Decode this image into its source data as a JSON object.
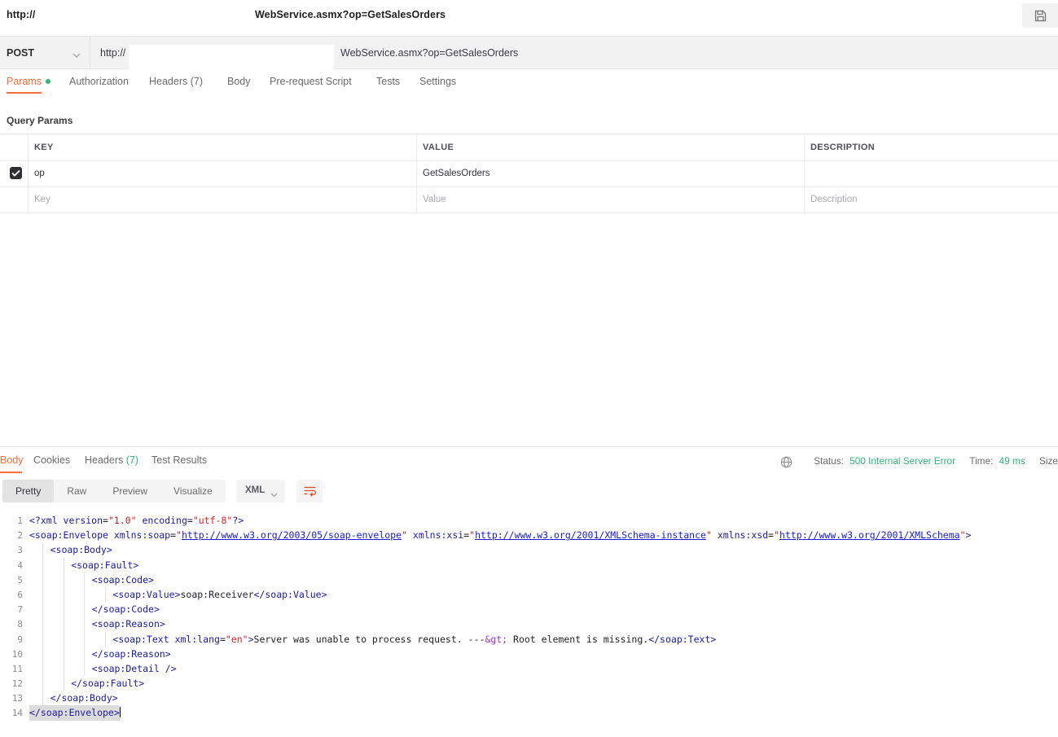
{
  "window": {
    "tab_title_prefix": "http://",
    "tab_title_suffix": "WebService.asmx?op=GetSalesOrders",
    "save_icon": "save-icon"
  },
  "request": {
    "method": "POST",
    "url_prefix": "http://",
    "url_suffix": "WebService.asmx?op=GetSalesOrders",
    "tabs": [
      {
        "label": "Params",
        "active": true,
        "has_dot": true
      },
      {
        "label": "Authorization",
        "active": false,
        "has_dot": false
      },
      {
        "label": "Headers (7)",
        "active": false,
        "has_dot": false
      },
      {
        "label": "Body",
        "active": false,
        "has_dot": false
      },
      {
        "label": "Pre-request Script",
        "active": false,
        "has_dot": false
      },
      {
        "label": "Tests",
        "active": false,
        "has_dot": false
      },
      {
        "label": "Settings",
        "active": false,
        "has_dot": false
      }
    ],
    "section_label": "Query Params",
    "table": {
      "headers": [
        "KEY",
        "VALUE",
        "DESCRIPTION"
      ],
      "rows": [
        {
          "checked": true,
          "key": "op",
          "value": "GetSalesOrders",
          "description": ""
        }
      ],
      "placeholder_row": {
        "key": "Key",
        "value": "Value",
        "description": "Description"
      }
    }
  },
  "response": {
    "tabs": [
      {
        "label": "Body",
        "active": true
      },
      {
        "label": "Cookies",
        "active": false
      },
      {
        "label": "Headers",
        "count": "(7)",
        "active": false
      },
      {
        "label": "Test Results",
        "active": false
      }
    ],
    "status_icon": "globe-icon",
    "status_label": "Status:",
    "status_value": "500 Internal Server Error",
    "time_label": "Time:",
    "time_value": "49 ms",
    "size_label": "Size",
    "format_tabs": [
      {
        "label": "Pretty",
        "active": true
      },
      {
        "label": "Raw",
        "active": false
      },
      {
        "label": "Preview",
        "active": false
      },
      {
        "label": "Visualize",
        "active": false
      }
    ],
    "language": "XML",
    "wrap_icon": "wrap-lines-icon",
    "accent_color": "#ff6c37",
    "status_color": "#31b57a",
    "body_lines": [
      {
        "n": "1",
        "parts": [
          {
            "t": "tag",
            "s": "<?xml "
          },
          {
            "t": "attr",
            "s": "version"
          },
          {
            "t": "txt",
            "s": "="
          },
          {
            "t": "str",
            "s": "\"1.0\""
          },
          {
            "t": "txt",
            "s": " "
          },
          {
            "t": "attr",
            "s": "encoding"
          },
          {
            "t": "txt",
            "s": "="
          },
          {
            "t": "str",
            "s": "\"utf-8\""
          },
          {
            "t": "tag",
            "s": "?>"
          }
        ]
      },
      {
        "n": "2",
        "parts": [
          {
            "t": "tag",
            "s": "<soap:Envelope "
          },
          {
            "t": "attr",
            "s": "xmlns:soap"
          },
          {
            "t": "txt",
            "s": "="
          },
          {
            "t": "str",
            "s": "\""
          },
          {
            "t": "url",
            "s": "http://www.w3.org/2003/05/soap-envelope"
          },
          {
            "t": "str",
            "s": "\""
          },
          {
            "t": "txt",
            "s": " "
          },
          {
            "t": "attr",
            "s": "xmlns:xsi"
          },
          {
            "t": "txt",
            "s": "="
          },
          {
            "t": "str",
            "s": "\""
          },
          {
            "t": "url",
            "s": "http://www.w3.org/2001/XMLSchema-instance"
          },
          {
            "t": "str",
            "s": "\""
          },
          {
            "t": "txt",
            "s": " "
          },
          {
            "t": "attr",
            "s": "xmlns:xsd"
          },
          {
            "t": "txt",
            "s": "="
          },
          {
            "t": "str",
            "s": "\""
          },
          {
            "t": "url",
            "s": "http://www.w3.org/2001/XMLSchema"
          },
          {
            "t": "str",
            "s": "\""
          },
          {
            "t": "tag",
            "s": ">"
          }
        ]
      },
      {
        "n": "3",
        "indent": 1,
        "parts": [
          {
            "t": "tag",
            "s": "<soap:Body>"
          }
        ]
      },
      {
        "n": "4",
        "indent": 2,
        "parts": [
          {
            "t": "tag",
            "s": "<soap:Fault>"
          }
        ]
      },
      {
        "n": "5",
        "indent": 3,
        "parts": [
          {
            "t": "tag",
            "s": "<soap:Code>"
          }
        ]
      },
      {
        "n": "6",
        "indent": 4,
        "parts": [
          {
            "t": "tag",
            "s": "<soap:Value>"
          },
          {
            "t": "txt",
            "s": "soap:Receiver"
          },
          {
            "t": "tag",
            "s": "</soap:Value>"
          }
        ]
      },
      {
        "n": "7",
        "indent": 3,
        "parts": [
          {
            "t": "tag",
            "s": "</soap:Code>"
          }
        ]
      },
      {
        "n": "8",
        "indent": 3,
        "parts": [
          {
            "t": "tag",
            "s": "<soap:Reason>"
          }
        ]
      },
      {
        "n": "9",
        "indent": 4,
        "parts": [
          {
            "t": "tag",
            "s": "<soap:Text "
          },
          {
            "t": "attr",
            "s": "xml:lang"
          },
          {
            "t": "txt",
            "s": "="
          },
          {
            "t": "str",
            "s": "\"en\""
          },
          {
            "t": "tag",
            "s": ">"
          },
          {
            "t": "txt",
            "s": "Server was unable to process request. ---"
          },
          {
            "t": "ent",
            "s": "&gt;"
          },
          {
            "t": "txt",
            "s": " Root element is missing."
          },
          {
            "t": "tag",
            "s": "</soap:Text>"
          }
        ]
      },
      {
        "n": "10",
        "indent": 3,
        "parts": [
          {
            "t": "tag",
            "s": "</soap:Reason>"
          }
        ]
      },
      {
        "n": "11",
        "indent": 3,
        "parts": [
          {
            "t": "tag",
            "s": "<soap:Detail />"
          }
        ]
      },
      {
        "n": "12",
        "indent": 2,
        "parts": [
          {
            "t": "tag",
            "s": "</soap:Fault>"
          }
        ]
      },
      {
        "n": "13",
        "indent": 1,
        "parts": [
          {
            "t": "tag",
            "s": "</soap:Body>"
          }
        ]
      },
      {
        "n": "14",
        "indent": 0,
        "selected": true,
        "caret": true,
        "parts": [
          {
            "t": "tag",
            "s": "</soap:Envelope>"
          }
        ]
      }
    ]
  }
}
